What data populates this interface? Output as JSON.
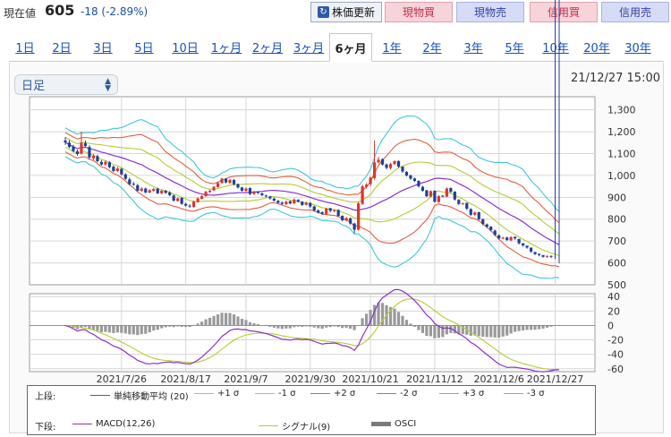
{
  "header": {
    "price_label": "現在値",
    "price_value": "605",
    "price_change": "-18 (-2.89%)",
    "refresh_label": "株価更新",
    "refresh_icon": "refresh-icon",
    "buttons": [
      {
        "label": "現物買",
        "color": "pink"
      },
      {
        "label": "現物売",
        "color": "blue"
      },
      {
        "label": "信用買",
        "color": "pink"
      },
      {
        "label": "信用売",
        "color": "blue"
      }
    ]
  },
  "tabs": [
    {
      "label": "1日",
      "active": false
    },
    {
      "label": "2日",
      "active": false
    },
    {
      "label": "3日",
      "active": false
    },
    {
      "label": "5日",
      "active": false
    },
    {
      "label": "10日",
      "active": false
    },
    {
      "label": "1ヶ月",
      "active": false
    },
    {
      "label": "2ヶ月",
      "active": false
    },
    {
      "label": "3ヶ月",
      "active": false
    },
    {
      "label": "6ヶ月",
      "active": true
    },
    {
      "label": "1年",
      "active": false
    },
    {
      "label": "2年",
      "active": false
    },
    {
      "label": "3年",
      "active": false
    },
    {
      "label": "5年",
      "active": false
    },
    {
      "label": "10年",
      "active": false
    },
    {
      "label": "20年",
      "active": false
    },
    {
      "label": "30年",
      "active": false
    }
  ],
  "controls": {
    "interval_label": "日足",
    "timestamp": "21/12/27 15:00"
  },
  "chart_data": [
    {
      "type": "candlestick",
      "title": "",
      "ylim": [
        500,
        1360
      ],
      "yticks": [
        500,
        600,
        700,
        800,
        900,
        1000,
        1100,
        1200,
        1300
      ],
      "ytick_labels": [
        "500",
        "600",
        "700",
        "800",
        "900",
        "1,000",
        "1,100",
        "1,200",
        "1,300"
      ],
      "x_labels": [
        "2021/7/26",
        "2021/8/17",
        "2021/9/7",
        "2021/9/30",
        "2021/10/21",
        "2021/11/12",
        "2021/12/6",
        "2021/12/27"
      ],
      "x_label_index": [
        14,
        30,
        45,
        61,
        76,
        92,
        108,
        122
      ],
      "x_count": 124,
      "grid": true,
      "colors": {
        "up": "#d9362f",
        "down": "#1f3f99",
        "sma": "#8a33c9",
        "band1": "#b5cc35",
        "band2": "#e0603e",
        "band3": "#40c8d6"
      },
      "close": [
        1152,
        1130,
        1112,
        1098,
        1150,
        1135,
        1082,
        1090,
        1065,
        1050,
        1062,
        1038,
        1020,
        1032,
        1005,
        985,
        960,
        958,
        930,
        940,
        922,
        932,
        938,
        918,
        930,
        920,
        910,
        885,
        895,
        870,
        862,
        858,
        880,
        895,
        905,
        925,
        930,
        948,
        965,
        985,
        968,
        980,
        960,
        945,
        930,
        940,
        915,
        925,
        920,
        910,
        905,
        895,
        885,
        875,
        870,
        880,
        872,
        890,
        880,
        865,
        875,
        858,
        840,
        830,
        825,
        848,
        838,
        840,
        815,
        795,
        805,
        780,
        752,
        872,
        950,
        958,
        990,
        1060,
        1072,
        1050,
        1035,
        1052,
        1065,
        1040,
        1018,
        1000,
        985,
        975,
        950,
        930,
        905,
        928,
        880,
        905,
        905,
        940,
        925,
        890,
        870,
        872,
        848,
        820,
        830,
        800,
        778,
        765,
        750,
        728,
        712,
        715,
        705,
        718,
        712,
        690,
        680,
        670,
        652,
        640,
        636,
        628,
        630,
        628,
        622,
        605
      ],
      "open": [
        1160,
        1150,
        1132,
        1110,
        1100,
        1148,
        1130,
        1078,
        1088,
        1062,
        1050,
        1060,
        1040,
        1020,
        1030,
        1005,
        982,
        962,
        955,
        930,
        940,
        922,
        930,
        940,
        918,
        930,
        922,
        908,
        883,
        897,
        870,
        862,
        856,
        878,
        893,
        906,
        924,
        932,
        947,
        966,
        985,
        966,
        980,
        960,
        945,
        930,
        942,
        915,
        926,
        918,
        908,
        904,
        894,
        884,
        876,
        868,
        882,
        872,
        888,
        880,
        866,
        874,
        858,
        840,
        832,
        824,
        850,
        836,
        842,
        815,
        795,
        804,
        780,
        752,
        870,
        948,
        960,
        988,
        1060,
        1074,
        1050,
        1034,
        1052,
        1066,
        1040,
        1016,
        1000,
        986,
        975,
        948,
        932,
        903,
        930,
        878,
        907,
        903,
        942,
        926,
        888,
        870,
        874,
        846,
        820,
        832,
        800,
        776,
        766,
        748,
        726,
        713,
        716,
        703,
        720,
        710,
        690,
        679,
        670,
        650,
        642,
        636,
        630,
        632
      ],
      "high": [
        1175,
        1162,
        1140,
        1118,
        1200,
        1160,
        1138,
        1098,
        1095,
        1070,
        1068,
        1065,
        1045,
        1040,
        1035,
        1010,
        990,
        970,
        962,
        946,
        945,
        938,
        944,
        944,
        935,
        934,
        928,
        912,
        900,
        900,
        875,
        868,
        885,
        900,
        910,
        930,
        936,
        952,
        970,
        990,
        988,
        985,
        982,
        963,
        948,
        945,
        945,
        930,
        928,
        922,
        912,
        906,
        898,
        888,
        880,
        885,
        885,
        895,
        892,
        882,
        880,
        878,
        862,
        845,
        836,
        853,
        852,
        845,
        845,
        818,
        810,
        808,
        784,
        880,
        958,
        965,
        995,
        1160,
        1085,
        1078,
        1055,
        1058,
        1070,
        1068,
        1042,
        1020,
        1004,
        990,
        978,
        952,
        934,
        932,
        932,
        910,
        910,
        946,
        945,
        928,
        892,
        876,
        876,
        850,
        836,
        834,
        802,
        780,
        768,
        752,
        730,
        720,
        720,
        722,
        716,
        694,
        684,
        675,
        656,
        645,
        640,
        634,
        636,
        634
      ],
      "low": [
        1140,
        1125,
        1105,
        1090,
        1095,
        1128,
        1075,
        1070,
        1060,
        1045,
        1045,
        1032,
        1015,
        1015,
        1000,
        980,
        955,
        952,
        925,
        925,
        918,
        918,
        925,
        915,
        914,
        916,
        905,
        880,
        880,
        866,
        858,
        852,
        852,
        875,
        890,
        902,
        920,
        928,
        944,
        962,
        964,
        962,
        955,
        940,
        926,
        926,
        910,
        912,
        915,
        905,
        900,
        890,
        880,
        870,
        865,
        865,
        868,
        870,
        876,
        860,
        862,
        852,
        835,
        826,
        820,
        820,
        832,
        832,
        810,
        790,
        790,
        775,
        735,
        748,
        865,
        940,
        950,
        980,
        1055,
        1045,
        1028,
        1028,
        1048,
        1035,
        1012,
        995,
        980,
        970,
        945,
        926,
        900,
        900,
        875,
        875,
        900,
        900,
        920,
        885,
        865,
        866,
        842,
        815,
        815,
        795,
        772,
        760,
        745,
        722,
        706,
        708,
        700,
        700,
        706,
        684,
        674,
        665,
        646,
        636,
        630,
        624,
        624,
        622,
        618,
        598
      ]
    },
    {
      "type": "line+bar",
      "title": "",
      "ylim": [
        -64,
        44
      ],
      "yticks": [
        -60,
        -40,
        -20,
        0,
        20,
        40
      ],
      "ytick_labels": [
        "-60",
        "-40",
        "-20",
        "0",
        "20",
        "40"
      ],
      "series": [
        {
          "name": "MACD(12,26)",
          "values": "macd"
        },
        {
          "name": "シグナル(9)",
          "values": "signal"
        },
        {
          "name": "OSCI",
          "values": "osci"
        }
      ],
      "grid": true
    }
  ],
  "legend": {
    "upper_title": "上段:",
    "lower_title": "下段:",
    "upper_items": [
      {
        "label": "単純移動平均 (20)",
        "color": "#8a33c9"
      },
      {
        "label": "+1 σ",
        "color": "#b5cc35"
      },
      {
        "label": "-1 σ",
        "color": "#b5cc35"
      },
      {
        "label": "+2 σ",
        "color": "#e0603e"
      },
      {
        "label": "-2 σ",
        "color": "#e0603e"
      },
      {
        "label": "+3 σ",
        "color": "#40c8d6"
      },
      {
        "label": "-3 σ",
        "color": "#40c8d6"
      }
    ],
    "lower_items": [
      {
        "label": "MACD(12,26)",
        "color": "#8a33c9"
      },
      {
        "label": "シグナル(9)",
        "color": "#b5cc35"
      },
      {
        "label": "OSCI",
        "color": "#7a7a7a"
      }
    ]
  }
}
